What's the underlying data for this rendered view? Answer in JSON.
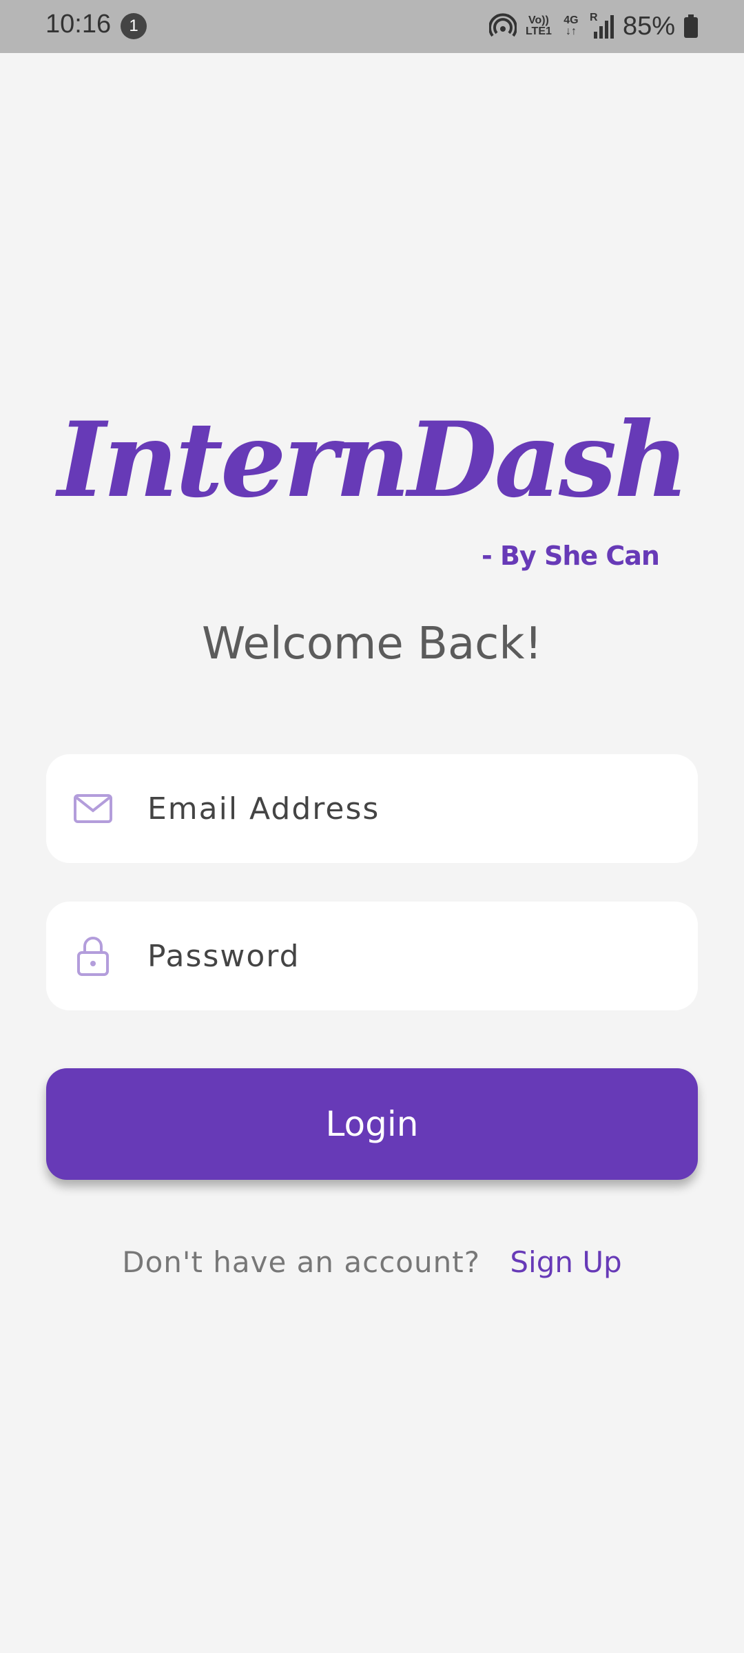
{
  "status_bar": {
    "time": "10:16",
    "notification_count": "1",
    "volte_label": "Vo)) LTE1",
    "network_label": "4G",
    "roaming_label": "R",
    "battery": "85%",
    "icons": [
      "hotspot-icon",
      "volte-icon",
      "data-arrows-icon",
      "signal-icon",
      "battery-icon"
    ]
  },
  "brand": {
    "title": "InternDash",
    "tagline": "- By She Can",
    "color": "#673ab7"
  },
  "welcome": "Welcome Back!",
  "form": {
    "email_placeholder": "Email Address",
    "email_icon": "mail-icon",
    "password_placeholder": "Password",
    "password_icon": "lock-icon",
    "login_label": "Login"
  },
  "signup": {
    "prompt": "Don't have an account?",
    "link_label": "Sign Up"
  },
  "colors": {
    "background": "#f4f4f4",
    "accent": "#673ab7",
    "icon_tint": "#b39ddb"
  }
}
